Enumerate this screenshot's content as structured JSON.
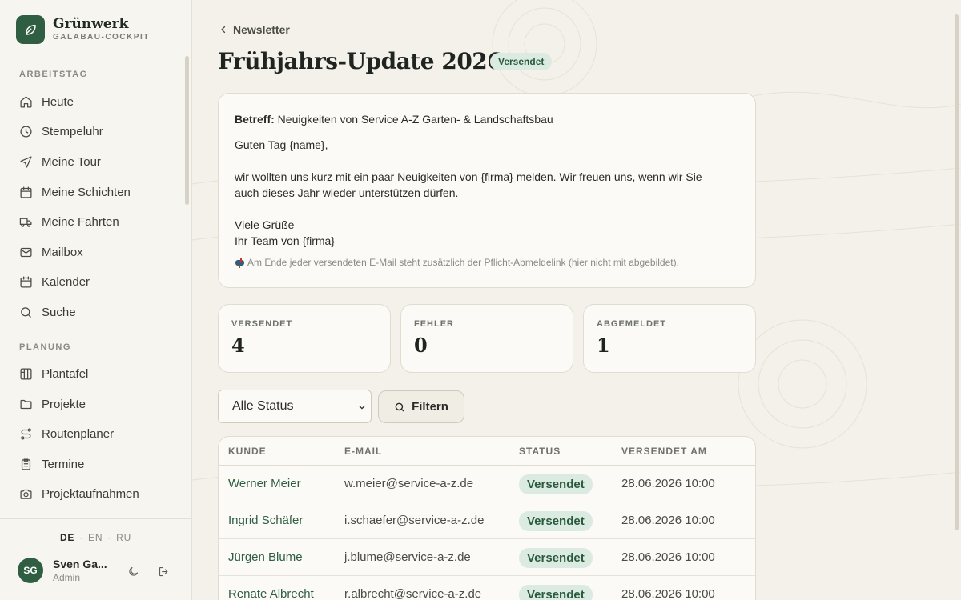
{
  "brand": {
    "name": "Grünwerk",
    "subtitle": "GALABAU-COCKPIT",
    "logo_icon": "leaf-icon"
  },
  "sidebar": {
    "sections": [
      {
        "label": "ARBEITSTAG"
      },
      {
        "label": "PLANUNG"
      }
    ],
    "items": [
      {
        "label": "Heute",
        "icon": "home-icon"
      },
      {
        "label": "Stempeluhr",
        "icon": "clock-icon"
      },
      {
        "label": "Meine Tour",
        "icon": "navigation-icon"
      },
      {
        "label": "Meine Schichten",
        "icon": "calendar-icon"
      },
      {
        "label": "Meine Fahrten",
        "icon": "truck-icon"
      },
      {
        "label": "Mailbox",
        "icon": "mail-icon"
      },
      {
        "label": "Kalender",
        "icon": "calendar-icon"
      },
      {
        "label": "Suche",
        "icon": "search-icon"
      },
      {
        "label": "Plantafel",
        "icon": "board-icon"
      },
      {
        "label": "Projekte",
        "icon": "folder-icon"
      },
      {
        "label": "Routenplaner",
        "icon": "route-icon"
      },
      {
        "label": "Termine",
        "icon": "clipboard-icon"
      },
      {
        "label": "Projektaufnahmen",
        "icon": "camera-icon"
      }
    ],
    "languages": [
      "DE",
      "EN",
      "RU"
    ],
    "active_language": "DE",
    "user": {
      "initials": "SG",
      "name": "Sven Ga...",
      "role": "Admin"
    }
  },
  "header": {
    "back_label": "Newsletter",
    "title": "Frühjahrs-Update 2026",
    "status": "Versendet"
  },
  "mail": {
    "subject_label": "Betreff:",
    "subject": "Neuigkeiten von Service A-Z Garten- & Landschaftsbau",
    "lines": [
      "Guten Tag {name},",
      "",
      "wir wollten uns kurz mit ein paar Neuigkeiten von {firma} melden. Wir freuen uns, wenn wir Sie",
      "auch dieses Jahr wieder unterstützen dürfen.",
      "",
      "Viele Grüße",
      "Ihr Team von {firma}"
    ],
    "note": "Am Ende jeder versendeten E-Mail steht zusätzlich der Pflicht-Abmeldelink (hier nicht mit abgebildet).",
    "note_icon": "mailbox-icon"
  },
  "stats": [
    {
      "label": "VERSENDET",
      "value": "4"
    },
    {
      "label": "FEHLER",
      "value": "0"
    },
    {
      "label": "ABGEMELDET",
      "value": "1"
    }
  ],
  "filter": {
    "select_value": "Alle Status",
    "button_label": "Filtern"
  },
  "table": {
    "columns": [
      "KUNDE",
      "E-MAIL",
      "STATUS",
      "VERSENDET AM"
    ],
    "rows": [
      {
        "name": "Werner Meier",
        "email": "w.meier@service-a-z.de",
        "status": "Versendet",
        "date": "28.06.2026 10:00"
      },
      {
        "name": "Ingrid Schäfer",
        "email": "i.schaefer@service-a-z.de",
        "status": "Versendet",
        "date": "28.06.2026 10:00"
      },
      {
        "name": "Jürgen Blume",
        "email": "j.blume@service-a-z.de",
        "status": "Versendet",
        "date": "28.06.2026 10:00"
      },
      {
        "name": "Renate Albrecht",
        "email": "r.albrecht@service-a-z.de",
        "status": "Versendet",
        "date": "28.06.2026 10:00"
      }
    ]
  },
  "colors": {
    "accent": "#2f5e43",
    "badge_bg": "#dcebe1",
    "background": "#f3f1ea"
  }
}
